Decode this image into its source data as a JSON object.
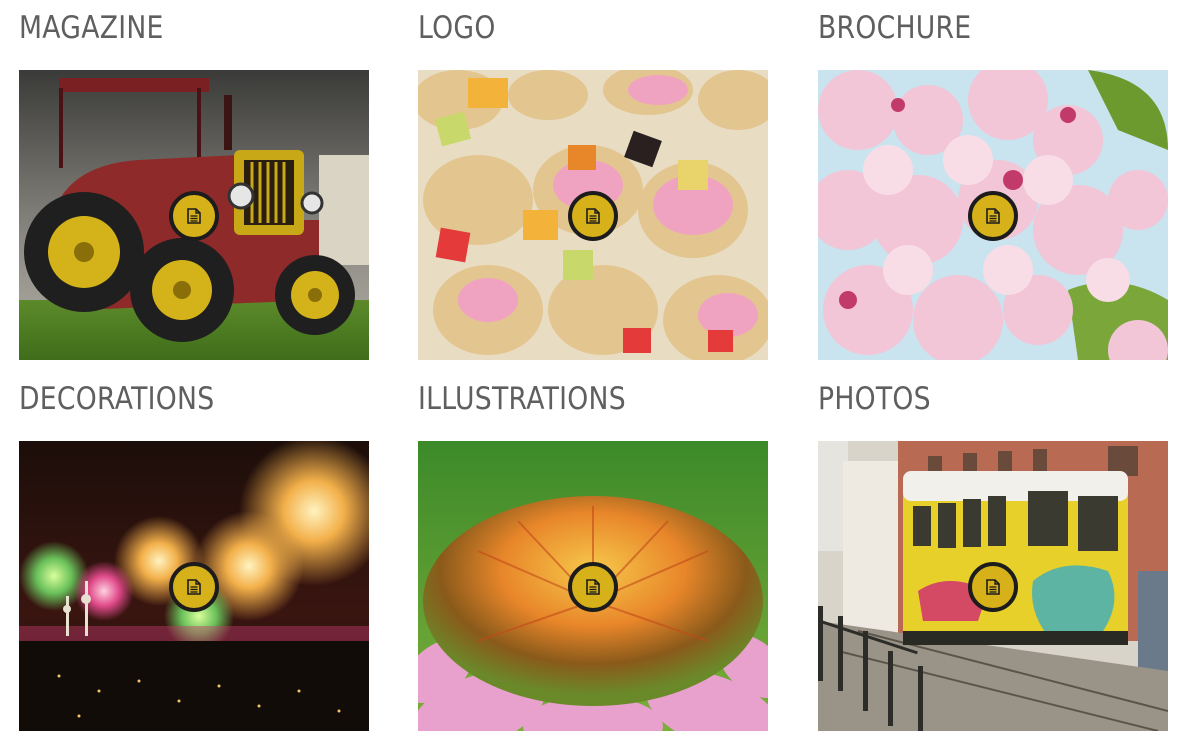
{
  "gallery": {
    "items": [
      {
        "title": "MAGAZINE",
        "icon": "document-icon",
        "image": "tractor-photo"
      },
      {
        "title": "LOGO",
        "icon": "document-icon",
        "image": "candy-cookies-photo"
      },
      {
        "title": "BROCHURE",
        "icon": "document-icon",
        "image": "cherry-blossom-photo"
      },
      {
        "title": "DECORATIONS",
        "icon": "document-icon",
        "image": "fireworks-photo"
      },
      {
        "title": "ILLUSTRATIONS",
        "icon": "document-icon",
        "image": "coneflower-photo"
      },
      {
        "title": "PHOTOS",
        "icon": "document-icon",
        "image": "tram-photo"
      }
    ]
  },
  "colors": {
    "heading": "#5f5f5f",
    "button_fill": "#d6b11a",
    "button_ring": "#1c1c1c"
  }
}
